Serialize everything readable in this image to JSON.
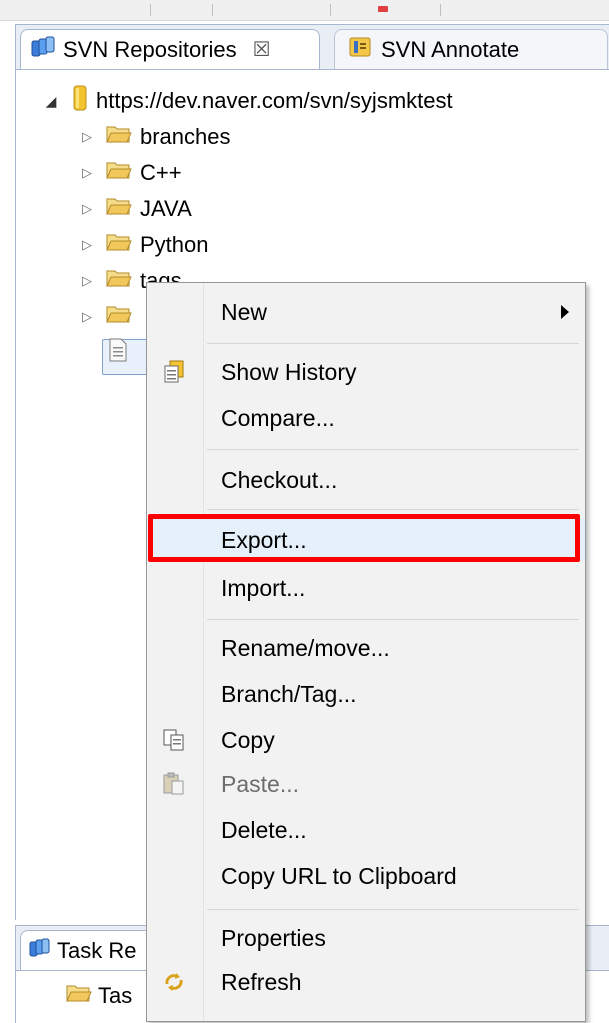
{
  "tabs": {
    "active": {
      "label": "SVN Repositories",
      "close": "☒"
    },
    "inactive": {
      "label": "SVN Annotate"
    }
  },
  "tree": {
    "root": {
      "label": "https://dev.naver.com/svn/syjsmktest"
    },
    "folders": [
      {
        "label": "branches"
      },
      {
        "label": "C++"
      },
      {
        "label": "JAVA"
      },
      {
        "label": "Python"
      },
      {
        "label": "tags"
      },
      {
        "label": ""
      }
    ]
  },
  "bottom_panel": {
    "tab_label": "Task Re",
    "row_label": "Tas"
  },
  "context_menu": {
    "items": [
      {
        "label": "New",
        "submenu": true,
        "icon": ""
      },
      {
        "label": "Show History",
        "icon": "history-icon"
      },
      {
        "label": "Compare...",
        "icon": ""
      },
      {
        "label": "Checkout...",
        "icon": ""
      },
      {
        "label": "Export...",
        "icon": ""
      },
      {
        "label": "Import...",
        "icon": ""
      },
      {
        "label": "Rename/move...",
        "icon": ""
      },
      {
        "label": "Branch/Tag...",
        "icon": ""
      },
      {
        "label": "Copy",
        "icon": "copy-icon"
      },
      {
        "label": "Paste...",
        "icon": "paste-icon",
        "disabled": true
      },
      {
        "label": "Delete...",
        "icon": ""
      },
      {
        "label": "Copy URL to Clipboard",
        "icon": ""
      },
      {
        "label": "Properties",
        "icon": ""
      },
      {
        "label": "Refresh",
        "icon": "refresh-icon"
      }
    ]
  },
  "colors": {
    "highlight": "#ff0000",
    "folder": "#f2c75c",
    "repo": "#f4c430",
    "tab_border": "#a7b7ce"
  }
}
